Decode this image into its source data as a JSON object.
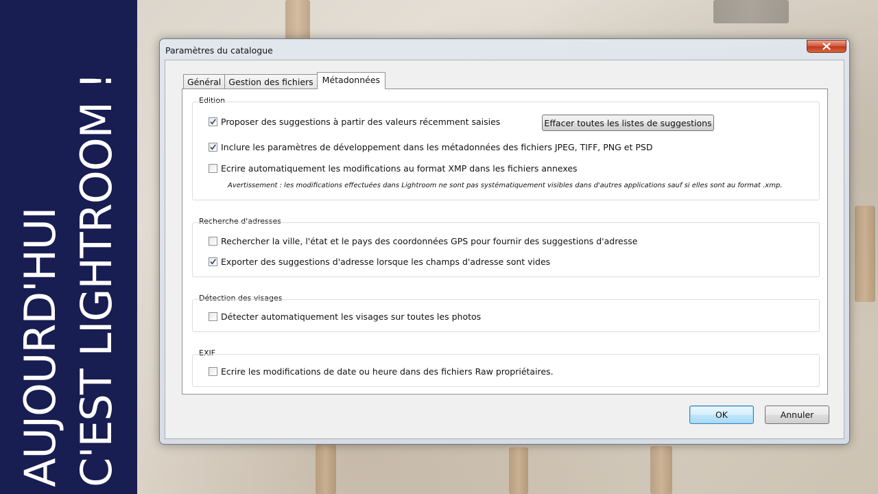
{
  "banner": {
    "line1": "AUJOURD'HUI",
    "line2": "C'EST LIGHTROOM !"
  },
  "dialog": {
    "title": "Paramètres du catalogue",
    "tabs": [
      {
        "label": "Général",
        "active": false
      },
      {
        "label": "Gestion des fichiers",
        "active": false
      },
      {
        "label": "Métadonnées",
        "active": true
      }
    ],
    "sections": {
      "edition": {
        "label": "Edition",
        "suggestions_label": "Proposer des suggestions à partir des valeurs récemment saisies",
        "suggestions_checked": true,
        "clear_button": "Effacer toutes les listes de suggestions",
        "include_label": "Inclure les paramètres de développement dans les métadonnées des fichiers JPEG, TIFF, PNG et PSD",
        "include_checked": true,
        "xmp_label": "Ecrire automatiquement les modifications au format XMP dans les fichiers annexes",
        "xmp_checked": false,
        "warning": "Avertissement : les modifications effectuées dans Lightroom ne sont pas systématiquement visibles dans d'autres applications sauf si elles sont au format .xmp."
      },
      "address": {
        "label": "Recherche d'adresses",
        "gps_label": "Rechercher la ville, l'état et le pays des coordonnées GPS pour fournir des suggestions d'adresse",
        "gps_checked": false,
        "export_label": "Exporter des suggestions d'adresse lorsque les champs d'adresse sont vides",
        "export_checked": true
      },
      "faces": {
        "label": "Détection des visages",
        "detect_label": "Détecter automatiquement les visages sur toutes les photos",
        "detect_checked": false
      },
      "exif": {
        "label": "EXIF",
        "write_label": "Ecrire les modifications de date ou heure dans des fichiers Raw propriétaires.",
        "write_checked": false
      }
    },
    "buttons": {
      "ok": "OK",
      "cancel": "Annuler"
    }
  },
  "colors": {
    "banner": "#181d52",
    "close_button": "#c0391f",
    "default_button_border": "#3c7fb1"
  }
}
